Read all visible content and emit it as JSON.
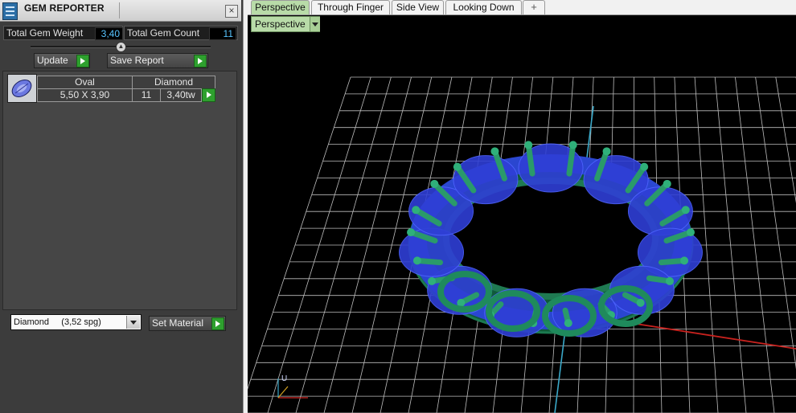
{
  "panel": {
    "title": "GEM REPORTER",
    "close_label": "×",
    "total_weight_label": "Total Gem Weight",
    "total_weight_value": "3,40",
    "total_count_label": "Total Gem Count",
    "total_count_value": "11",
    "update_label": "Update",
    "save_report_label": "Save Report",
    "gem_table": {
      "shape": "Oval",
      "size": "5,50 X 3,90",
      "material": "Diamond",
      "count": "11",
      "weight": "3,40tw"
    },
    "material_select": "Diamond     (3,52 spg)",
    "set_material_label": "Set Material"
  },
  "tabs": [
    "Perspective",
    "Through Finger",
    "Side View",
    "Looking Down"
  ],
  "tab_add_label": "+",
  "view_menu_label": "Perspective",
  "axis_label": "U",
  "colors": {
    "panel_bg": "#3c3c3c",
    "active_tab": "#b8dba8",
    "value_text": "#58c4ff",
    "ring_metal": "#1f7a52",
    "gem": "#2f3fd6",
    "grid": "#bdbdbd"
  }
}
